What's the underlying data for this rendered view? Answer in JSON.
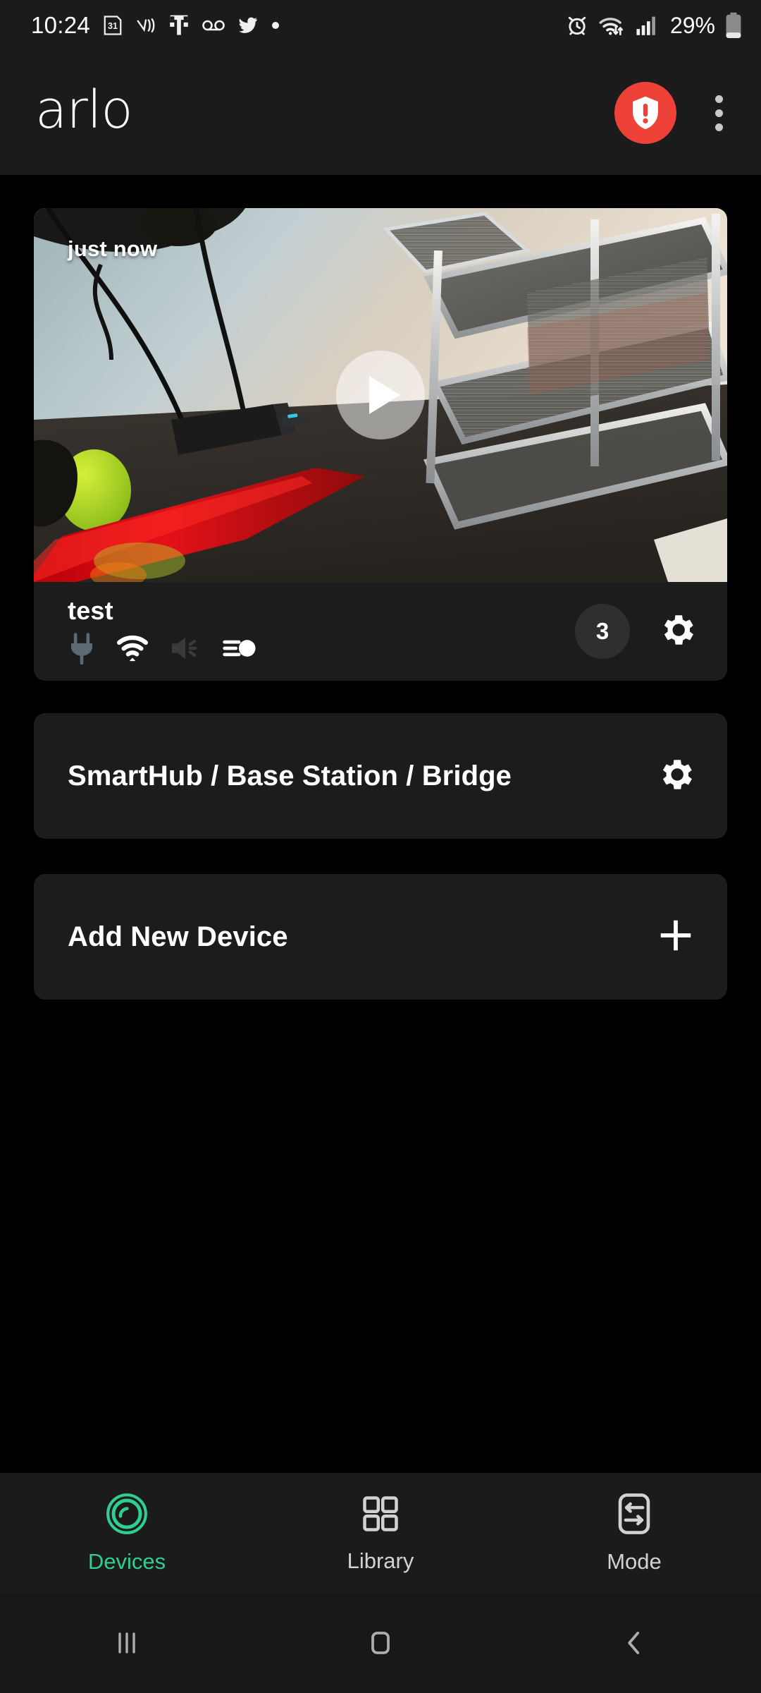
{
  "status_bar": {
    "time": "10:24",
    "battery_percent": "29%",
    "left_icons": [
      "calendar-31-icon",
      "vibrate-off-icon",
      "t-mobile-icon",
      "voicemail-icon",
      "twitter-icon",
      "dot-icon"
    ],
    "right_icons": [
      "alarm-icon",
      "wifi-transfer-icon",
      "cellular-signal-icon",
      "battery-icon"
    ]
  },
  "app_bar": {
    "logo_text": "arlo",
    "alert_icon": "shield-exclamation-icon",
    "alert_color": "#ee4238",
    "overflow_icon": "kebab-menu-icon"
  },
  "camera_card": {
    "timestamp_label": "just now",
    "play_icon": "play-icon",
    "name": "test",
    "status_icons": [
      {
        "name": "power-plug-icon",
        "state": "disconnected",
        "color": "#5d6a73"
      },
      {
        "name": "wifi-signal-icon",
        "state": "connected",
        "color": "#ffffff"
      },
      {
        "name": "speaker-muted-icon",
        "state": "off",
        "color": "#3a3a3a"
      },
      {
        "name": "spotlight-icon",
        "state": "on",
        "color": "#ffffff"
      }
    ],
    "recording_count": "3",
    "settings_icon": "gear-icon"
  },
  "rows": [
    {
      "label": "SmartHub / Base Station / Bridge",
      "icon": "gear-icon",
      "id": "hub"
    },
    {
      "label": "Add New Device",
      "icon": "plus-icon",
      "id": "add"
    }
  ],
  "bottom_nav": {
    "active_color": "#2ecf90",
    "inactive_color": "#d2d2d2",
    "items": [
      {
        "label": "Devices",
        "icon": "camera-lens-icon",
        "active": true
      },
      {
        "label": "Library",
        "icon": "grid-squares-icon",
        "active": false
      },
      {
        "label": "Mode",
        "icon": "mode-toggle-icon",
        "active": false
      }
    ]
  },
  "android_nav": {
    "items": [
      {
        "icon": "recents-icon"
      },
      {
        "icon": "home-icon"
      },
      {
        "icon": "back-icon"
      }
    ]
  }
}
